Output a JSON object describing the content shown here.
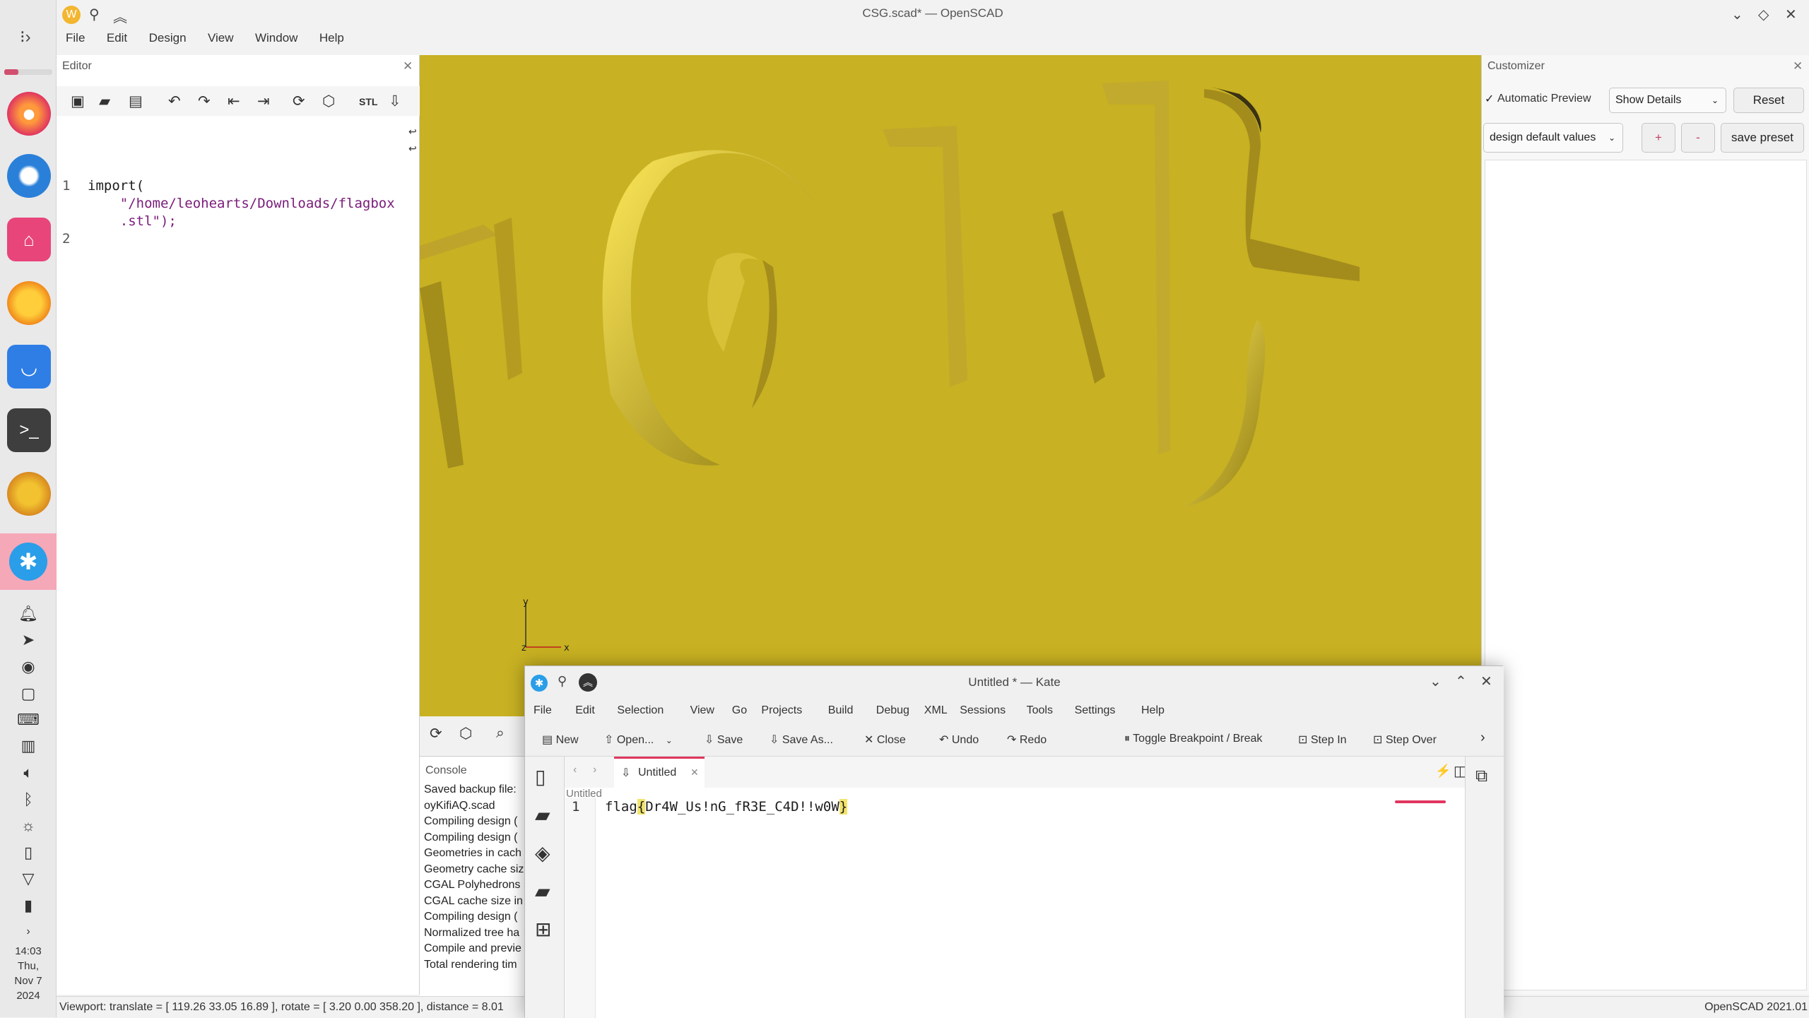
{
  "window": {
    "title": "CSG.scad* — OpenSCAD"
  },
  "menu": [
    "File",
    "Edit",
    "Design",
    "View",
    "Window",
    "Help"
  ],
  "editor": {
    "title": "Editor",
    "lines": [
      {
        "num": "1",
        "text": "import("
      },
      {
        "num": "",
        "text": "    \"/home/leohearts/Downloads/flagbox"
      },
      {
        "num": "",
        "text": "    .stl\");"
      },
      {
        "num": "2",
        "text": ""
      }
    ]
  },
  "viewport": {
    "axis_labels": {
      "x": "x",
      "y": "y",
      "z": "z"
    }
  },
  "console": {
    "title": "Console",
    "lines": [
      "Saved backup file: ",
      "oyKifiAQ.scad",
      "Compiling design (",
      "Compiling design (",
      "Geometries in cach",
      "Geometry cache siz",
      "CGAL Polyhedrons",
      "CGAL cache size in",
      "Compiling design (",
      "Normalized tree ha",
      "Compile and previe",
      "Total rendering tim"
    ]
  },
  "customizer": {
    "title": "Customizer",
    "automatic_preview": "Automatic Preview",
    "automatic_preview_checked": true,
    "show_details": "Show Details",
    "reset": "Reset",
    "preset": "design default values",
    "plus": "+",
    "minus": "-",
    "save_preset": "save preset"
  },
  "status": {
    "viewport": "Viewport: translate = [ 119.26 33.05 16.89 ], rotate = [ 3.20 0.00 358.20 ], distance = 8.01",
    "version": "OpenSCAD 2021.01"
  },
  "clock": {
    "time": "14:03",
    "day": "Thu,",
    "date": "Nov 7",
    "year": "2024"
  },
  "kate": {
    "title": "Untitled * — Kate",
    "menu": [
      "File",
      "Edit",
      "Selection",
      "View",
      "Go",
      "Projects",
      "Build",
      "Debug",
      "XML",
      "Sessions",
      "Tools",
      "Settings",
      "Help"
    ],
    "toolbar": {
      "new": "New",
      "open": "Open...",
      "save": "Save",
      "save_as": "Save As...",
      "close": "Close",
      "undo": "Undo",
      "redo": "Redo",
      "toggle_breakpoint": "Toggle Breakpoint / Break",
      "step_in": "Step In",
      "step_over": "Step Over"
    },
    "tab": "Untitled",
    "breadcrumb": "Untitled",
    "line_number": "1",
    "text_prefix": "flag",
    "brace_open": "{",
    "text_body": "Dr4W_Us!nG_fR3E_C4D!!w0W",
    "brace_close": "}"
  },
  "colors": {
    "viewport_bg": "#c8b122",
    "accent": "#e0365f",
    "kate_brace_highlight": "#f2e46b"
  }
}
